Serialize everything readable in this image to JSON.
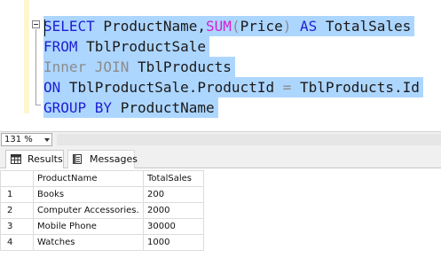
{
  "editor": {
    "lines": [
      [
        {
          "t": "SELECT",
          "c": "kw"
        },
        {
          "t": " ProductName,",
          "c": "tx"
        },
        {
          "t": "SUM",
          "c": "fn"
        },
        {
          "t": "(",
          "c": "gr"
        },
        {
          "t": "Price",
          "c": "tx"
        },
        {
          "t": ")",
          "c": "gr"
        },
        {
          "t": " AS ",
          "c": "kw"
        },
        {
          "t": "TotalSales",
          "c": "tx"
        }
      ],
      [
        {
          "t": "FROM",
          "c": "kw"
        },
        {
          "t": " TblProductSale",
          "c": "tx"
        }
      ],
      [
        {
          "t": "Inner JOIN",
          "c": "gr"
        },
        {
          "t": " TblProducts",
          "c": "tx"
        }
      ],
      [
        {
          "t": "ON",
          "c": "kw"
        },
        {
          "t": " TblProductSale.ProductId ",
          "c": "tx"
        },
        {
          "t": "=",
          "c": "gr"
        },
        {
          "t": " TblProducts.Id",
          "c": "tx"
        }
      ],
      [
        {
          "t": "GROUP BY",
          "c": "kw"
        },
        {
          "t": " ProductName",
          "c": "tx"
        }
      ]
    ]
  },
  "zoom": {
    "value": "131 %"
  },
  "tabs": {
    "results_label": "Results",
    "messages_label": "Messages"
  },
  "grid": {
    "columns": [
      "ProductName",
      "TotalSales"
    ],
    "rows": [
      {
        "num": "1",
        "cells": [
          "Books",
          "200"
        ]
      },
      {
        "num": "2",
        "cells": [
          "Computer Accessories.",
          "2000"
        ]
      },
      {
        "num": "3",
        "cells": [
          "Mobile Phone",
          "30000"
        ]
      },
      {
        "num": "4",
        "cells": [
          "Watches",
          "1000"
        ]
      }
    ]
  }
}
